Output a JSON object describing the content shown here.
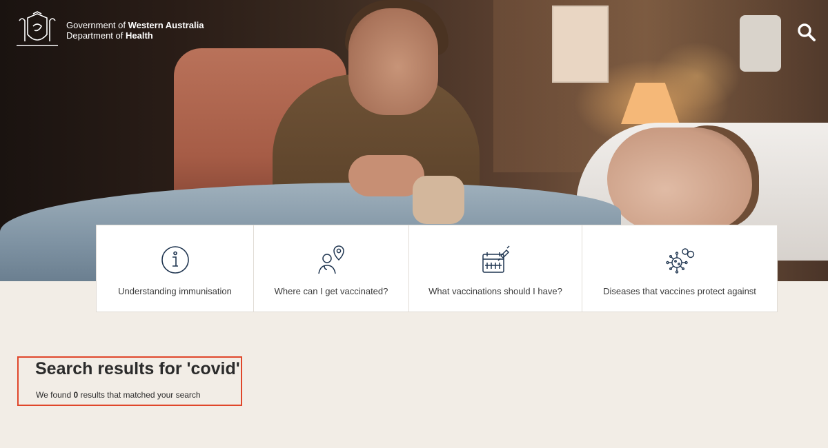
{
  "header": {
    "brand": {
      "line1_prefix": "Government of ",
      "line1_bold": "Western Australia",
      "line2_prefix": "Department of ",
      "line2_bold": "Health"
    },
    "search_icon": "search-icon"
  },
  "hero": {
    "image": "photo of mother holding hand of child in hospital bed"
  },
  "tiles": [
    {
      "label": "Understanding immunisation",
      "icon": "info-icon"
    },
    {
      "label": "Where can I get vaccinated?",
      "icon": "doctor-location-icon"
    },
    {
      "label": "What vaccinations should I have?",
      "icon": "calendar-syringe-icon"
    },
    {
      "label": "Diseases that vaccines protect against",
      "icon": "virus-icon"
    }
  ],
  "results": {
    "heading": "Search results for 'covid'",
    "summary_prefix": "We found ",
    "count": "0",
    "summary_suffix": " results that matched your search"
  },
  "colors": {
    "page_bg": "#f2ede6",
    "highlight_border": "#e0462a",
    "icon_stroke": "#1f3550"
  }
}
